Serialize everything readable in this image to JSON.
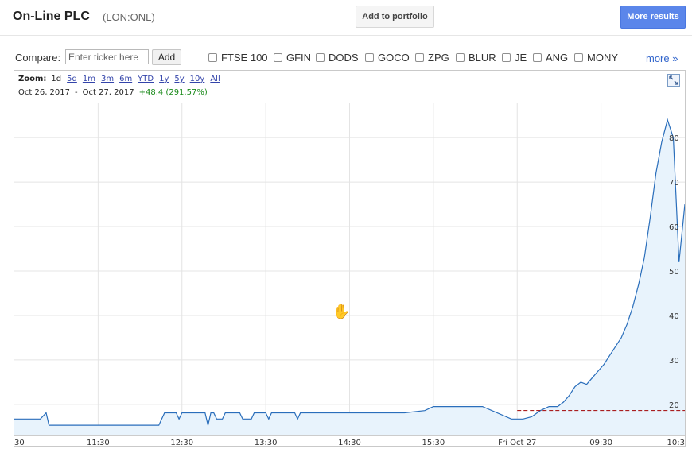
{
  "header": {
    "company": "On-Line PLC",
    "ticker": "(LON:ONL)",
    "add_portfolio_label": "Add to portfolio",
    "more_results_label": "More results"
  },
  "compare": {
    "label": "Compare:",
    "placeholder": "Enter ticker here",
    "add_label": "Add",
    "tickers": [
      "FTSE 100",
      "GFIN",
      "DODS",
      "GOCO",
      "ZPG",
      "BLUR",
      "JE",
      "ANG",
      "MONY"
    ],
    "more_label": "more »"
  },
  "zoom": {
    "label": "Zoom:",
    "options": [
      "1d",
      "5d",
      "1m",
      "3m",
      "6m",
      "YTD",
      "1y",
      "5y",
      "10y",
      "All"
    ],
    "active": "1d"
  },
  "range": {
    "start": "Oct 26, 2017",
    "separator": "-",
    "end": "Oct 27, 2017",
    "change": "+48.4 (291.57%)"
  },
  "colors": {
    "line": "#2a6ebb",
    "fill": "#e8f3fc",
    "prev_close": "#a00000",
    "grid": "#e4e4e4",
    "link": "#3366cc",
    "change": "#1a8a1a"
  },
  "icons": {
    "expand": "expand-arrows-icon",
    "cursor": "hand-cursor-icon"
  },
  "chart_data": {
    "type": "line",
    "title": "",
    "xlabel": "",
    "ylabel": "",
    "xticks": [
      "30",
      "11:30",
      "12:30",
      "13:30",
      "14:30",
      "15:30",
      "Fri Oct 27",
      "09:30",
      "10:3"
    ],
    "yticks": [
      20,
      30,
      40,
      50,
      60,
      70,
      80
    ],
    "ylim": [
      13,
      87
    ],
    "grid": true,
    "prev_close": 18.6,
    "series": [
      {
        "x": [
          0,
          0.09,
          0.11,
          0.115,
          0.12,
          0.5,
          0.51,
          0.52,
          0.55,
          0.56,
          0.57,
          0.58,
          0.59,
          0.6,
          0.66,
          0.67,
          0.68,
          0.69,
          0.7,
          0.72,
          0.73,
          0.74,
          0.75,
          0.77,
          0.78,
          0.79,
          0.8,
          0.82,
          0.83,
          0.84,
          0.85,
          0.86,
          0.87,
          0.88,
          0.89,
          0.9,
          0.91,
          0.92,
          0.93,
          0.94,
          0.95,
          0.96,
          0.97,
          0.98,
          0.99,
          1.0,
          1.15,
          1.2,
          1.25,
          1.35,
          1.42,
          1.45,
          1.5,
          1.55,
          1.62,
          1.72,
          1.76,
          1.79,
          1.82,
          1.85,
          1.88,
          1.9,
          1.92,
          1.94,
          1.96,
          1.98,
          2.0,
          2.02,
          2.04,
          2.06,
          2.08,
          2.1,
          2.12,
          2.14,
          2.16,
          2.18,
          2.2,
          2.22,
          2.24,
          2.26,
          2.28,
          2.3,
          2.32
        ],
        "y": [
          16.7,
          16.7,
          18.1,
          16.7,
          15.3,
          15.3,
          16.7,
          18.1,
          18.1,
          18.1,
          16.7,
          18.1,
          18.1,
          18.1,
          18.1,
          15.3,
          18.1,
          18.1,
          16.7,
          16.7,
          18.1,
          18.1,
          18.1,
          18.1,
          18.1,
          16.7,
          16.7,
          16.7,
          18.1,
          18.1,
          18.1,
          18.1,
          18.1,
          16.7,
          18.1,
          18.1,
          18.1,
          18.1,
          18.1,
          18.1,
          18.1,
          18.1,
          18.1,
          16.7,
          18.1,
          18.1,
          18.1,
          18.1,
          18.1,
          18.1,
          18.6,
          19.5,
          19.5,
          19.5,
          19.5,
          16.7,
          16.7,
          17.2,
          18.6,
          19.5,
          19.5,
          20.5,
          22.0,
          24.0,
          25.0,
          24.5,
          26.0,
          27.5,
          29.0,
          31.0,
          33.0,
          35.0,
          38.0,
          42.0,
          47.0,
          53.0,
          62.0,
          72.0,
          79.0,
          84.0,
          80.0,
          52.0,
          65.0
        ]
      }
    ]
  }
}
